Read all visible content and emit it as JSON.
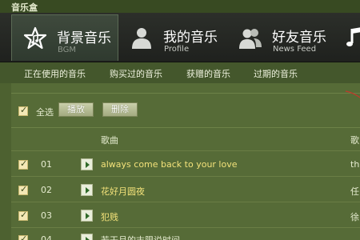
{
  "window": {
    "title": "音乐盒"
  },
  "nav": {
    "tabs": [
      {
        "label": "背景音乐",
        "sub": "BGM",
        "icon": "star-note-icon",
        "active": true
      },
      {
        "label": "我的音乐",
        "sub": "Profile",
        "icon": "person-icon",
        "active": false
      },
      {
        "label": "好友音乐",
        "sub": "News Feed",
        "icon": "people-icon",
        "active": false
      },
      {
        "label": "",
        "sub": "",
        "icon": "music-note-icon",
        "active": false
      }
    ]
  },
  "subnav": {
    "items": [
      "正在使用的音乐",
      "购买过的音乐",
      "获赠的音乐",
      "过期的音乐"
    ]
  },
  "toolbar": {
    "select_all_label": "全选",
    "play_label": "播放",
    "delete_label": "删除"
  },
  "table": {
    "columns": {
      "song": "歌曲",
      "artist": "歌"
    },
    "rows": [
      {
        "num": "01",
        "song": "always come back to your love",
        "artist": "th",
        "checked": true
      },
      {
        "num": "02",
        "song": "花好月圆夜",
        "artist": "任",
        "checked": true
      },
      {
        "num": "03",
        "song": "犯贱",
        "artist": "徐",
        "checked": true
      },
      {
        "num": "04",
        "song": "若干月的末限说时间",
        "artist": "",
        "checked": true
      }
    ]
  },
  "colors": {
    "background": "#4d6130",
    "navbar": "#2c2f2a",
    "song_text": "#f3e27a",
    "checkbox": "#f3e8b6"
  }
}
